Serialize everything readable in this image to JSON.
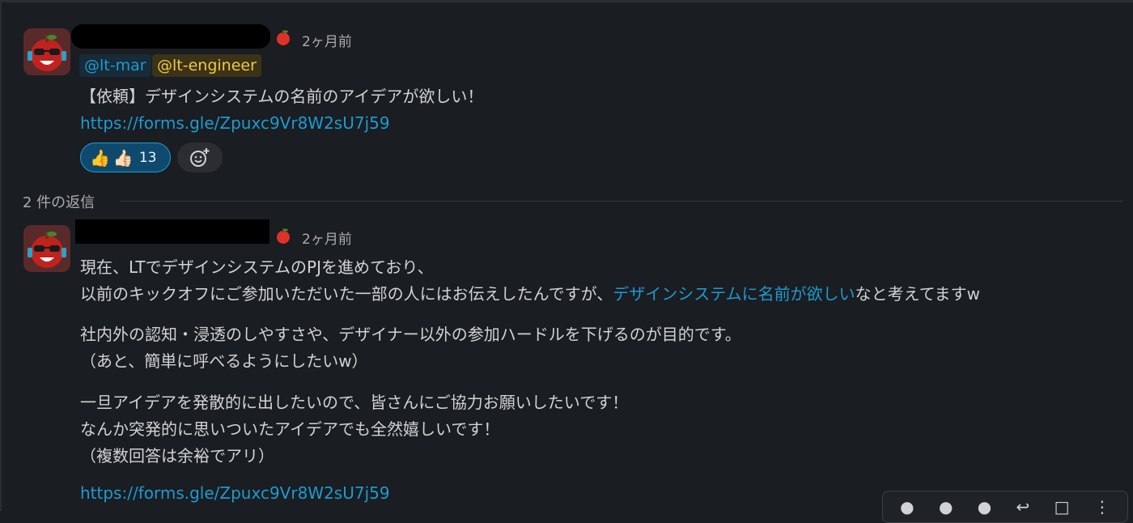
{
  "parent": {
    "time": "2ヶ月前",
    "mentions": [
      "@lt-mar",
      "@lt-engineer"
    ],
    "text": "【依頼】デザインシステムの名前のアイデアが欲しい！",
    "link": "https://forms.gle/Zpuxc9Vr8W2sU7j59",
    "reaction": {
      "emojis": [
        "👍",
        "👍🏻"
      ],
      "count": "13"
    },
    "add_reaction_icon": "add-emoji-icon"
  },
  "replies_label": "2 件の返信",
  "reply": {
    "time": "2ヶ月前",
    "p1_line1": "現在、LTでデザインシステムのPJを進めており、",
    "p1_line2_pre": "以前のキックオフにご参加いただいた一部の人にはお伝えしたんですが、",
    "p1_line2_link": "デザインシステムに名前が欲しい",
    "p1_line2_post": "なと考えてますw",
    "p2_line1": "社内外の認知・浸透のしやすさや、デザイナー以外の参加ハードルを下げるのが目的です。",
    "p2_line2": "（あと、簡単に呼べるようにしたいw）",
    "p3_line1": "一旦アイデアを発散的に出したいので、皆さんにご協力お願いしたいです！",
    "p3_line2": "なんか突発的に思いついたアイデアでも全然嬉しいです！",
    "p3_line3": "（複数回答は余裕でアリ）",
    "link": "https://forms.gle/Zpuxc9Vr8W2sU7j59"
  },
  "hover_actions": [
    "emoji-react-1",
    "emoji-react-2",
    "emoji-react-3",
    "reply-icon",
    "bookmark-icon",
    "more-icon"
  ]
}
